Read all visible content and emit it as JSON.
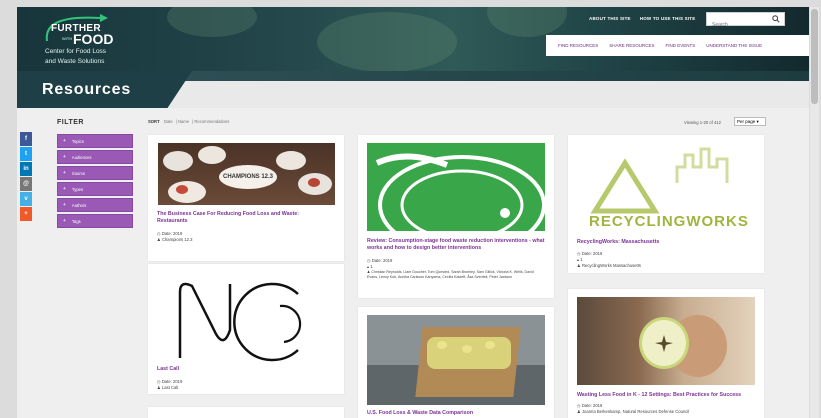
{
  "header": {
    "logo": {
      "line1": "FURTHER",
      "line2": "WITH",
      "line3": "FOOD",
      "tagline1": "Center for Food Loss",
      "tagline2": "and Waste Solutions"
    },
    "top_links": [
      "ABOUT THIS SITE",
      "HOW TO USE THIS SITE"
    ],
    "search": {
      "placeholder": "Search"
    },
    "nav": [
      "FIND RESOURCES",
      "SHARE RESOURCES",
      "FIND EVENTS",
      "UNDERSTAND THE ISSUE"
    ]
  },
  "page_title": "Resources",
  "social": [
    "f",
    "t",
    "in",
    "@",
    "v",
    "+"
  ],
  "filter": {
    "title": "FILTER",
    "items": [
      "Topics",
      "Audiences",
      "Source",
      "Types",
      "Authors",
      "Tags"
    ]
  },
  "sort": {
    "label": "SORT",
    "options": [
      "Date",
      "Name",
      "Recommendations"
    ]
  },
  "viewing": "Viewing 1-20 of 412",
  "per_page": "Per page",
  "cards": [
    {
      "title": "The Business Case For Reducing Food Loss and Waste: Restaurants",
      "date": "Date: 2019",
      "author": "Champions 12.3",
      "image_text": "CHAMPIONS 12.3"
    },
    {
      "title": "Review: Consumption-stage food waste reduction interventions - what works and how to design better interventions",
      "date": "Date: 2019",
      "count": "1",
      "author": "Christian Reynolds, Liam Goucher, Tom Quested, Sarah Bromley, Sam Gillick, Victoria K. Wells, David Evans, Lenny Koh, Annika Carlsson Kanyama, Cecilia Katzeff, Åsa Svenfelt, Peter Jackson"
    },
    {
      "title": "RecyclingWorks: Massachusetts",
      "date": "Date: 2019",
      "count": "1",
      "author": "RecyclingWorks Massachusetts",
      "image_text": "RECYCLINGWORKS"
    },
    {
      "title": "Last Call",
      "date": "Date: 2019",
      "author": "Last Call"
    },
    {
      "title": "U.S. Food Loss & Waste Data Comparison"
    },
    {
      "title": "Wasting Less Food in K - 12 Settings: Best Practices for Success",
      "date": "Date: 2019",
      "author": "Joanna Berkenkamp, Natural Resources Defense Council"
    }
  ],
  "colors": {
    "accent": "#7b3295",
    "filter": "#9b59b6",
    "header": "#1e3f45"
  }
}
